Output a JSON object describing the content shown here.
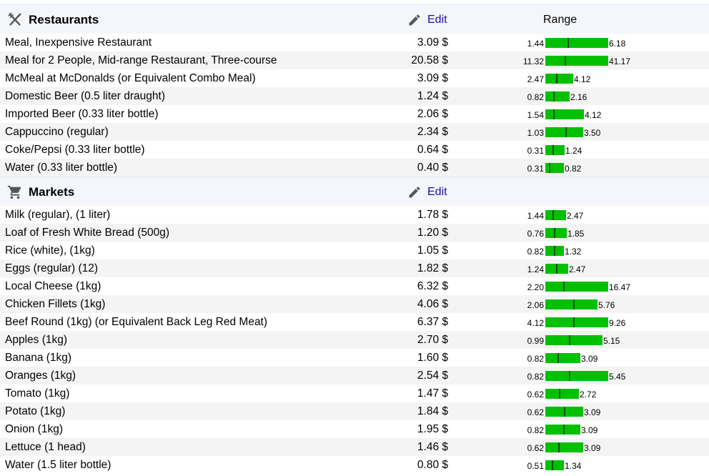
{
  "sections": [
    {
      "icon": "utensils-icon",
      "title": "Restaurants",
      "edit_label": "Edit",
      "range_header": "Range",
      "rows": [
        {
          "label": "Meal, Inexpensive Restaurant",
          "price": "3.09 $",
          "min": "1.44",
          "max": "6.18",
          "value": 3.09,
          "low": 1.44,
          "high": 6.18
        },
        {
          "label": "Meal for 2 People, Mid-range Restaurant, Three-course",
          "price": "20.58 $",
          "min": "11.32",
          "max": "41.17",
          "value": 20.58,
          "low": 11.32,
          "high": 41.17
        },
        {
          "label": "McMeal at McDonalds (or Equivalent Combo Meal)",
          "price": "3.09 $",
          "min": "2.47",
          "max": "4.12",
          "value": 3.09,
          "low": 2.47,
          "high": 4.12
        },
        {
          "label": "Domestic Beer (0.5 liter draught)",
          "price": "1.24 $",
          "min": "0.82",
          "max": "2.16",
          "value": 1.24,
          "low": 0.82,
          "high": 2.16
        },
        {
          "label": "Imported Beer (0.33 liter bottle)",
          "price": "2.06 $",
          "min": "1.54",
          "max": "4.12",
          "value": 2.06,
          "low": 1.54,
          "high": 4.12
        },
        {
          "label": "Cappuccino (regular)",
          "price": "2.34 $",
          "min": "1.03",
          "max": "3.50",
          "value": 2.34,
          "low": 1.03,
          "high": 3.5
        },
        {
          "label": "Coke/Pepsi (0.33 liter bottle)",
          "price": "0.64 $",
          "min": "0.31",
          "max": "1.24",
          "value": 0.64,
          "low": 0.31,
          "high": 1.24
        },
        {
          "label": "Water (0.33 liter bottle)",
          "price": "0.40 $",
          "min": "0.31",
          "max": "0.82",
          "value": 0.4,
          "low": 0.31,
          "high": 0.82
        }
      ]
    },
    {
      "icon": "shopping-cart-icon",
      "title": "Markets",
      "edit_label": "Edit",
      "range_header": "",
      "rows": [
        {
          "label": "Milk (regular), (1 liter)",
          "price": "1.78 $",
          "min": "1.44",
          "max": "2.47",
          "value": 1.78,
          "low": 1.44,
          "high": 2.47
        },
        {
          "label": "Loaf of Fresh White Bread (500g)",
          "price": "1.20 $",
          "min": "0.76",
          "max": "1.85",
          "value": 1.2,
          "low": 0.76,
          "high": 1.85
        },
        {
          "label": "Rice (white), (1kg)",
          "price": "1.05 $",
          "min": "0.82",
          "max": "1.32",
          "value": 1.05,
          "low": 0.82,
          "high": 1.32
        },
        {
          "label": "Eggs (regular) (12)",
          "price": "1.82 $",
          "min": "1.24",
          "max": "2.47",
          "value": 1.82,
          "low": 1.24,
          "high": 2.47
        },
        {
          "label": "Local Cheese (1kg)",
          "price": "6.32 $",
          "min": "2.20",
          "max": "16.47",
          "value": 6.32,
          "low": 2.2,
          "high": 16.47
        },
        {
          "label": "Chicken Fillets (1kg)",
          "price": "4.06 $",
          "min": "2.06",
          "max": "5.76",
          "value": 4.06,
          "low": 2.06,
          "high": 5.76
        },
        {
          "label": "Beef Round (1kg) (or Equivalent Back Leg Red Meat)",
          "price": "6.37 $",
          "min": "4.12",
          "max": "9.26",
          "value": 6.37,
          "low": 4.12,
          "high": 9.26
        },
        {
          "label": "Apples (1kg)",
          "price": "2.70 $",
          "min": "0.99",
          "max": "5.15",
          "value": 2.7,
          "low": 0.99,
          "high": 5.15
        },
        {
          "label": "Banana (1kg)",
          "price": "1.60 $",
          "min": "0.82",
          "max": "3.09",
          "value": 1.6,
          "low": 0.82,
          "high": 3.09
        },
        {
          "label": "Oranges (1kg)",
          "price": "2.54 $",
          "min": "0.82",
          "max": "5.45",
          "value": 2.54,
          "low": 0.82,
          "high": 5.45
        },
        {
          "label": "Tomato (1kg)",
          "price": "1.47 $",
          "min": "0.62",
          "max": "2.72",
          "value": 1.47,
          "low": 0.62,
          "high": 2.72
        },
        {
          "label": "Potato (1kg)",
          "price": "1.84 $",
          "min": "0.62",
          "max": "3.09",
          "value": 1.84,
          "low": 0.62,
          "high": 3.09
        },
        {
          "label": "Onion (1kg)",
          "price": "1.95 $",
          "min": "0.82",
          "max": "3.09",
          "value": 1.95,
          "low": 0.82,
          "high": 3.09
        },
        {
          "label": "Lettuce (1 head)",
          "price": "1.46 $",
          "min": "0.62",
          "max": "3.09",
          "value": 1.46,
          "low": 0.62,
          "high": 3.09
        },
        {
          "label": "Water (1.5 liter bottle)",
          "price": "0.80 $",
          "min": "0.51",
          "max": "1.34",
          "value": 0.8,
          "low": 0.51,
          "high": 1.34
        }
      ]
    }
  ],
  "colors": {
    "bar": "#00c000",
    "marker": "#0a4f0a",
    "link": "#1a0dab",
    "header_bg": "#f4f6fb",
    "row_alt": "#f4f4f4"
  }
}
